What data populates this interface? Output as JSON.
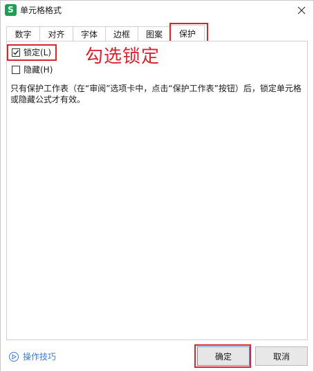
{
  "window": {
    "title": "单元格格式",
    "app_icon_letter": "S",
    "accent_color": "#1f9e55"
  },
  "tabs": [
    {
      "label": "数字",
      "active": false
    },
    {
      "label": "对齐",
      "active": false
    },
    {
      "label": "字体",
      "active": false
    },
    {
      "label": "边框",
      "active": false
    },
    {
      "label": "图案",
      "active": false
    },
    {
      "label": "保护",
      "active": true
    }
  ],
  "protection": {
    "locked": {
      "label": "锁定(L)",
      "checked": true
    },
    "hidden": {
      "label": "隐藏(H)",
      "checked": false
    },
    "description": "只有保护工作表（在“审阅”选项卡中，点击“保护工作表”按钮）后，锁定单元格或隐藏公式才有效。"
  },
  "annotation": {
    "text": "勾选锁定",
    "color": "#d9232e"
  },
  "footer": {
    "tips_label": "操作技巧",
    "ok_label": "确定",
    "cancel_label": "取消"
  }
}
